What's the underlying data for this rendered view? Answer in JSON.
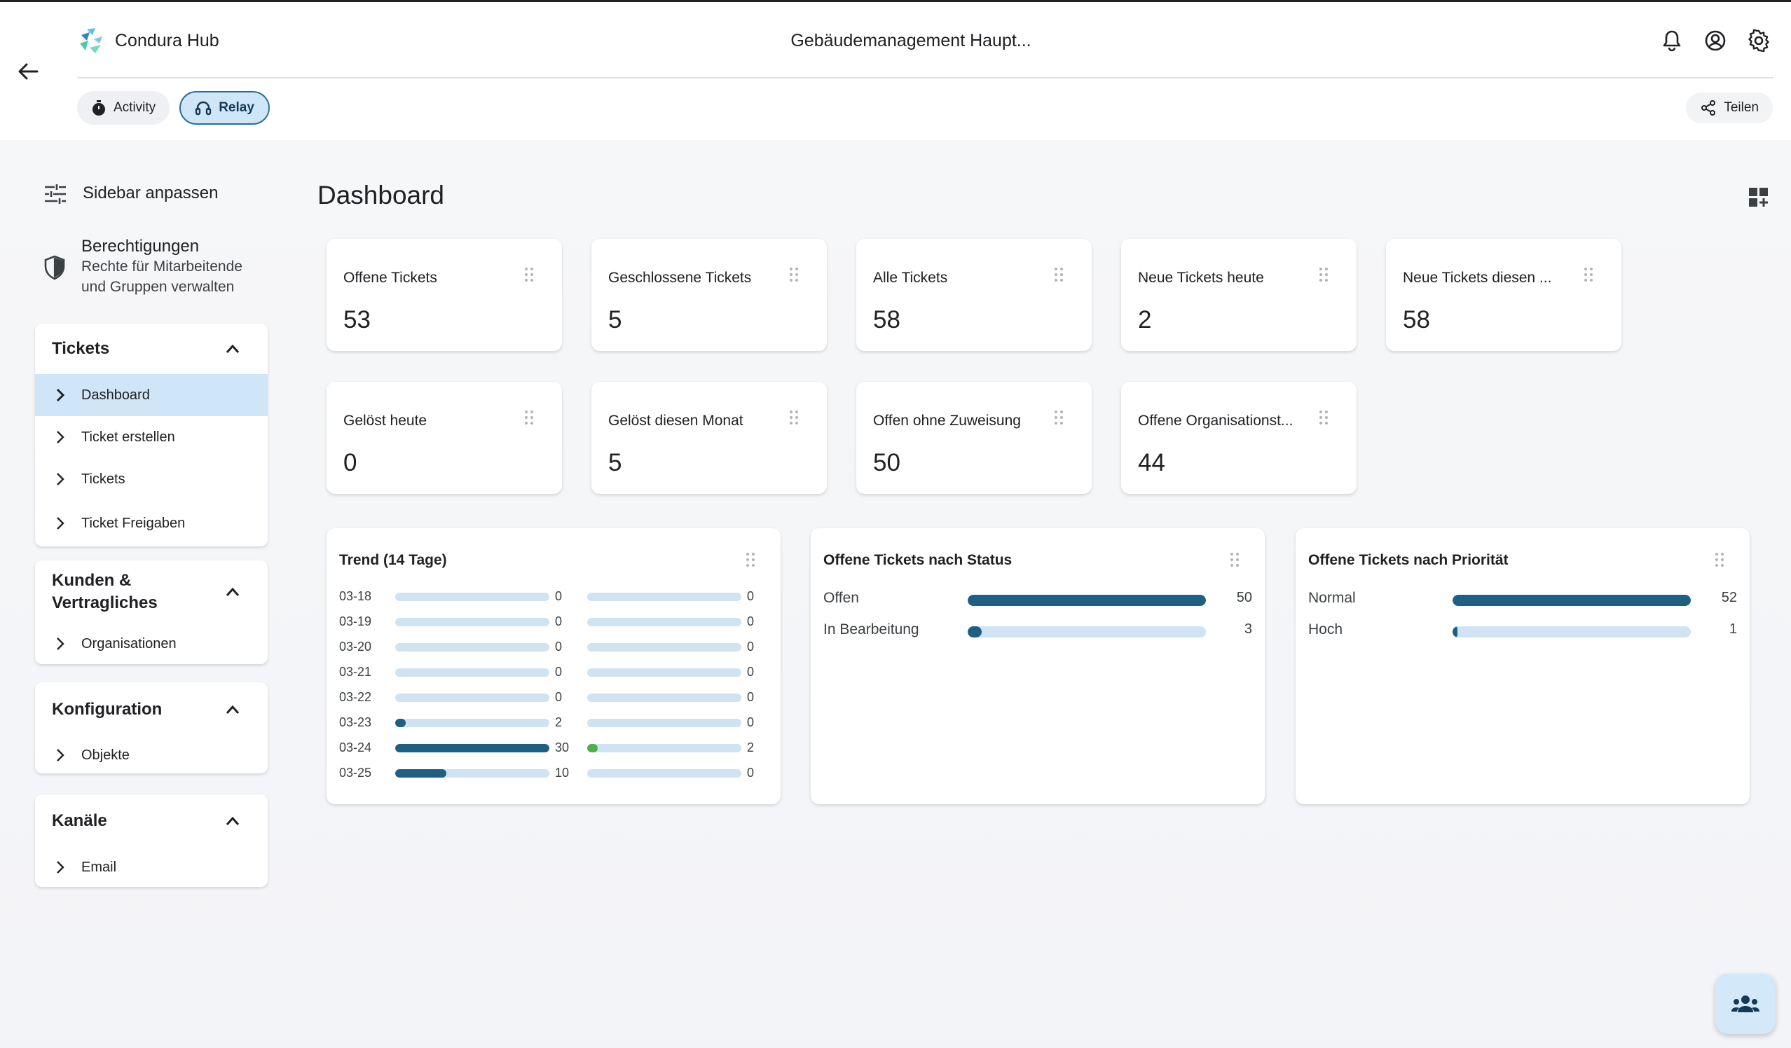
{
  "header": {
    "brand": "Condura Hub",
    "title": "Gebäudemanagement Haupt...",
    "chips": [
      {
        "label": "Activity",
        "icon": "stopwatch-icon"
      },
      {
        "label": "Relay",
        "icon": "headset-icon"
      }
    ],
    "share_label": "Teilen"
  },
  "sidebar": {
    "customize_label": "Sidebar anpassen",
    "permissions": {
      "title": "Berechtigungen",
      "line1": "Rechte für Mitarbeitende",
      "line2": "und Gruppen verwalten"
    },
    "sections": [
      {
        "title": "Tickets",
        "items": [
          "Dashboard",
          "Ticket erstellen",
          "Tickets",
          "Ticket Freigaben"
        ]
      },
      {
        "title_line1": "Kunden &",
        "title_line2": "Vertragliches",
        "items": [
          "Organisationen"
        ]
      },
      {
        "title": "Konfiguration",
        "items": [
          "Objekte"
        ]
      },
      {
        "title": "Kanäle",
        "items": [
          "Email"
        ]
      }
    ]
  },
  "dashboard": {
    "title": "Dashboard",
    "kpis": [
      {
        "label": "Offene Tickets",
        "value": "53"
      },
      {
        "label": "Geschlossene Tickets",
        "value": "5"
      },
      {
        "label": "Alle Tickets",
        "value": "58"
      },
      {
        "label": "Neue Tickets heute",
        "value": "2"
      },
      {
        "label": "Neue Tickets diesen ...",
        "value": "58"
      },
      {
        "label": "Gelöst heute",
        "value": "0"
      },
      {
        "label": "Gelöst diesen Monat",
        "value": "5"
      },
      {
        "label": "Offen ohne Zuweisung",
        "value": "50"
      },
      {
        "label": "Offene Organisationst...",
        "value": "44"
      }
    ],
    "trend": {
      "title": "Trend (14 Tage)",
      "rows": [
        {
          "date": "03-18",
          "a": 0,
          "b": 0
        },
        {
          "date": "03-19",
          "a": 0,
          "b": 0
        },
        {
          "date": "03-20",
          "a": 0,
          "b": 0
        },
        {
          "date": "03-21",
          "a": 0,
          "b": 0
        },
        {
          "date": "03-22",
          "a": 0,
          "b": 0
        },
        {
          "date": "03-23",
          "a": 2,
          "b": 0
        },
        {
          "date": "03-24",
          "a": 30,
          "b": 2
        },
        {
          "date": "03-25",
          "a": 10,
          "b": 0
        }
      ],
      "max_a": 30,
      "max_b": 30,
      "color_a": "#1f5f82",
      "color_b": "#4caf50"
    },
    "status": {
      "title": "Offene Tickets nach Status",
      "rows": [
        {
          "label": "Offen",
          "value": 50
        },
        {
          "label": "In Bearbeitung",
          "value": 3
        }
      ],
      "max": 50
    },
    "priority": {
      "title": "Offene Tickets nach Priorität",
      "rows": [
        {
          "label": "Normal",
          "value": 52
        },
        {
          "label": "Hoch",
          "value": 1
        }
      ],
      "max": 52
    }
  },
  "colors": {
    "accent": "#1f5f82",
    "track": "#cfe3f2",
    "active_bg": "#cfe6f8",
    "active_border": "#2a6f97"
  }
}
